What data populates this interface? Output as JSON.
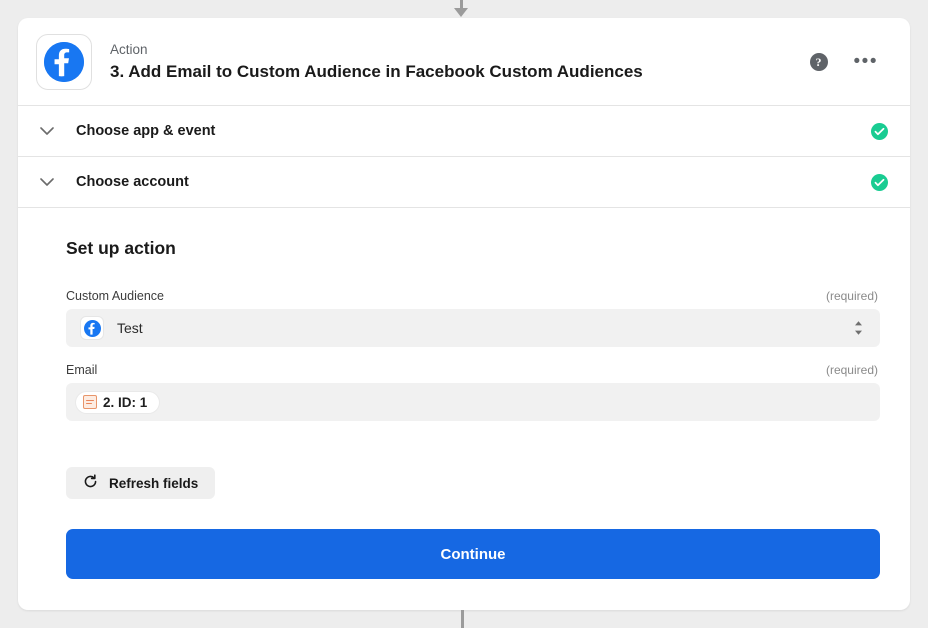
{
  "connectors": {
    "top_arrow": "down-arrow-connector",
    "bottom_line": "vertical-line-connector"
  },
  "header": {
    "app_icon": "facebook-icon",
    "kicker": "Action",
    "title": "3. Add Email to Custom Audience in Facebook Custom Audiences",
    "help_icon": "help-circle-icon",
    "help_glyph": "?",
    "more_icon": "ellipsis-icon",
    "more_glyph": "•••"
  },
  "sections": [
    {
      "label": "Choose app & event",
      "icon": "chevron-down-icon",
      "status": "complete",
      "status_icon": "check-circle-icon"
    },
    {
      "label": "Choose account",
      "icon": "chevron-down-icon",
      "status": "complete",
      "status_icon": "check-circle-icon"
    }
  ],
  "setup": {
    "title": "Set up action",
    "fields": [
      {
        "label": "Custom Audience",
        "required_text": "(required)",
        "type": "select",
        "value": "Test",
        "value_icon": "facebook-icon",
        "arrows_icon": "select-updown-arrows-icon"
      },
      {
        "label": "Email",
        "required_text": "(required)",
        "type": "token",
        "token_text": "2. ID: 1",
        "token_icon": "data-field-icon"
      }
    ],
    "refresh_button": {
      "label": "Refresh fields",
      "icon": "refresh-icon"
    },
    "continue_button": {
      "label": "Continue"
    }
  },
  "colors": {
    "page_background": "#ededed",
    "card_background": "#ffffff",
    "facebook_blue": "#1877f2",
    "primary_button": "#1668e3",
    "success_green": "#19cc92",
    "field_background": "#f1f1f1",
    "token_accent": "#e8855a"
  }
}
